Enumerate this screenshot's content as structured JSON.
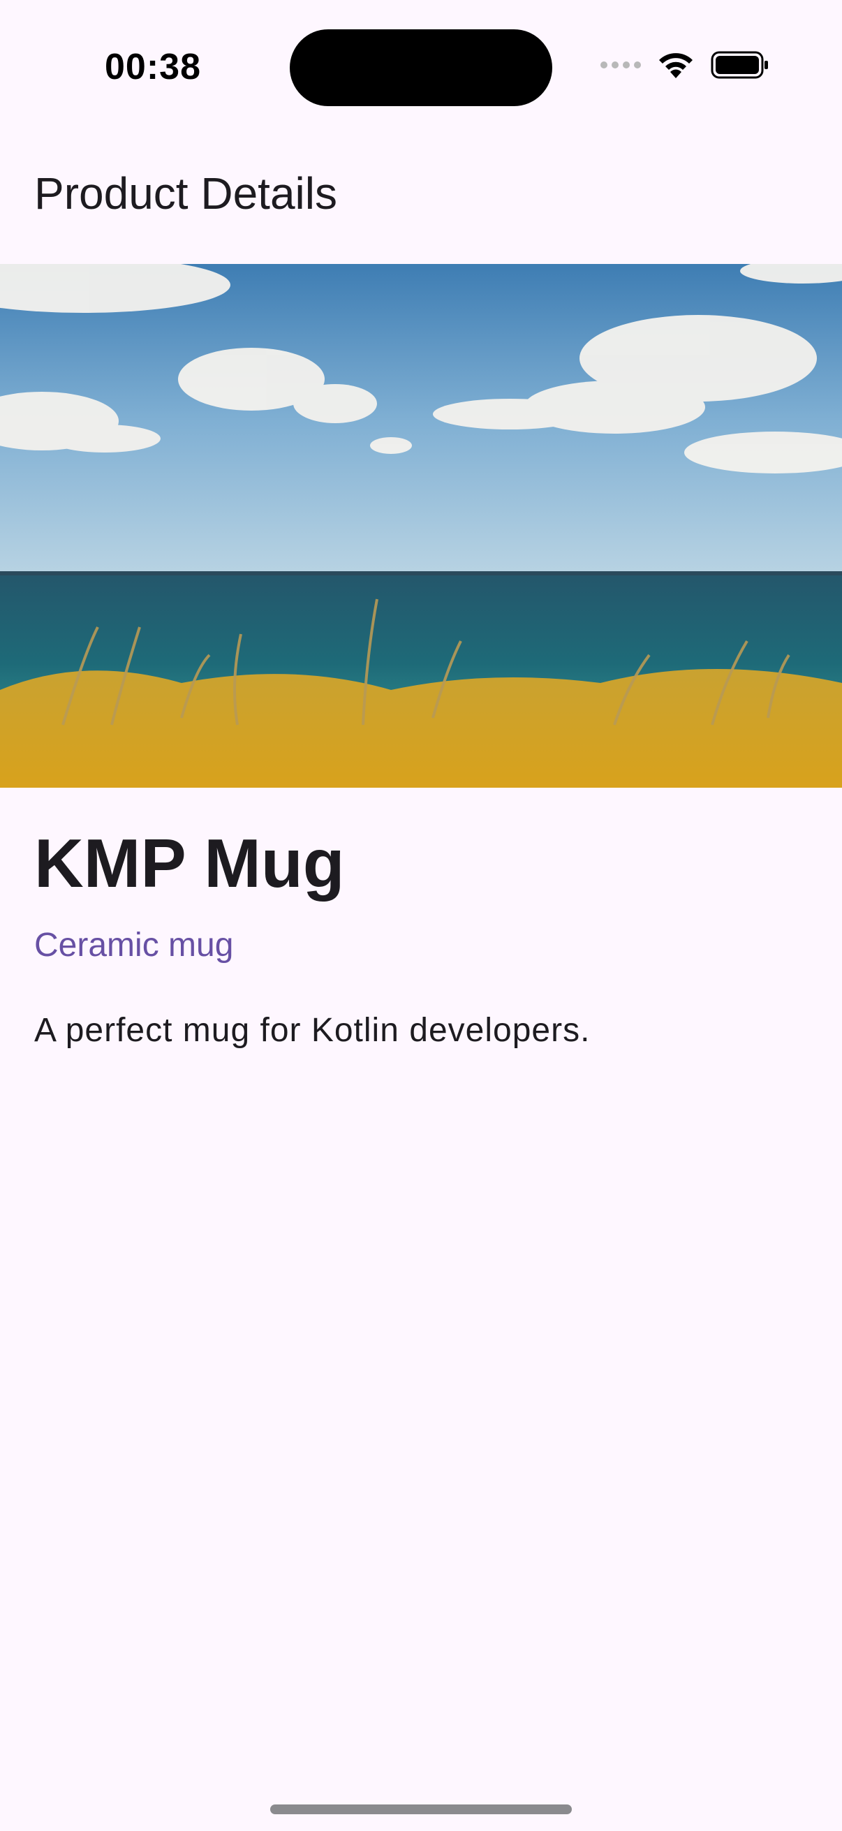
{
  "status_bar": {
    "time": "00:38",
    "icons": [
      "signal-dots-icon",
      "wifi-icon",
      "battery-icon"
    ]
  },
  "app_bar": {
    "title": "Product Details"
  },
  "product": {
    "image_icon": "landscape-photo",
    "name": "KMP Mug",
    "category": "Ceramic mug",
    "description": "A perfect mug for Kotlin developers."
  },
  "colors": {
    "background": "#FEF7FF",
    "accent": "#6750A4",
    "text": "#1D1B20"
  }
}
